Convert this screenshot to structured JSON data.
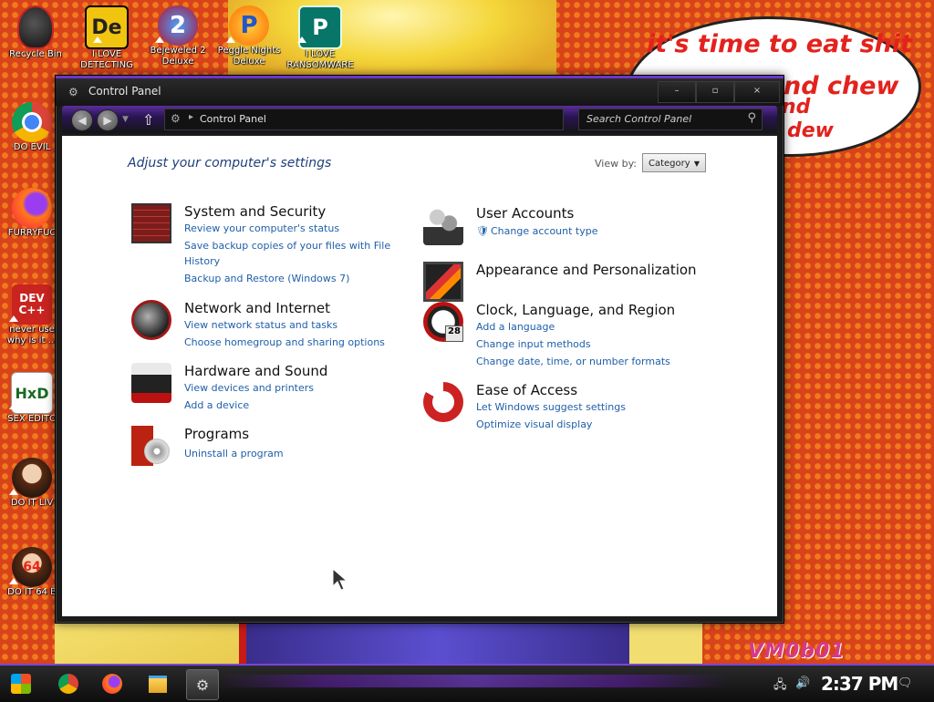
{
  "desktop": {
    "icons": [
      {
        "label_1": "Recycle Bin",
        "label_2": ""
      },
      {
        "label_1": "I LOVE",
        "label_2": "DETECTING",
        "glyph": "De"
      },
      {
        "label_1": "Bejeweled 2",
        "label_2": "Deluxe",
        "glyph": "2"
      },
      {
        "label_1": "Peggle Nights",
        "label_2": "Deluxe",
        "glyph": "P"
      },
      {
        "label_1": "I LOVE",
        "label_2": "RANSOMWARE",
        "glyph": "P"
      },
      {
        "label_1": "DO EVIL",
        "label_2": ""
      },
      {
        "label_1": "FURRYFUC",
        "label_2": ""
      },
      {
        "label_1": "never use",
        "label_2": "why is it ...",
        "glyph": "DEV C++"
      },
      {
        "label_1": "SEX EDITO",
        "label_2": "",
        "glyph": "HxD"
      },
      {
        "label_1": "DO IT LIV",
        "label_2": ""
      },
      {
        "label_1": "DO IT 64 B",
        "label_2": "",
        "glyph": "64"
      }
    ],
    "bubble_lines": [
      "it's time to eat shit",
      "nd chew",
      "nd",
      "dew"
    ],
    "watermark": "VM0b01"
  },
  "window": {
    "title": "Control Panel",
    "caption": {
      "minimize": "–",
      "maximize": "▫",
      "close": "×"
    },
    "address_crumb": "Control Panel",
    "search_placeholder": "Search Control Panel",
    "heading": "Adjust your computer's settings",
    "view_by_label": "View by:",
    "view_by_value": "Category",
    "categories_left": [
      {
        "title": "System and Security",
        "links": [
          "Review your computer's status",
          "Save backup copies of your files with File",
          "History",
          "Backup and Restore (Windows 7)"
        ]
      },
      {
        "title": "Network and Internet",
        "links": [
          "View network status and tasks",
          "Choose homegroup and sharing options"
        ]
      },
      {
        "title": "Hardware and Sound",
        "links": [
          "View devices and printers",
          "Add a device"
        ]
      },
      {
        "title": "Programs",
        "links": [
          "Uninstall a program"
        ]
      }
    ],
    "categories_right": [
      {
        "title": "User Accounts",
        "links": [
          "Change account type"
        ]
      },
      {
        "title": "Appearance and Personalization",
        "links": []
      },
      {
        "title": "Clock, Language, and Region",
        "links": [
          "Add a language",
          "Change input methods",
          "Change date, time, or number formats"
        ]
      },
      {
        "title": "Ease of Access",
        "links": [
          "Let Windows suggest settings",
          "Optimize visual display"
        ]
      }
    ]
  },
  "taskbar": {
    "clock": "2:37 PM",
    "calendar_day": "28"
  },
  "colors": {
    "accent_purple": "#7a45d8",
    "link_blue": "#1f5fa9",
    "heading_blue": "#1e3f7a",
    "bubble_red": "#e3221d"
  }
}
